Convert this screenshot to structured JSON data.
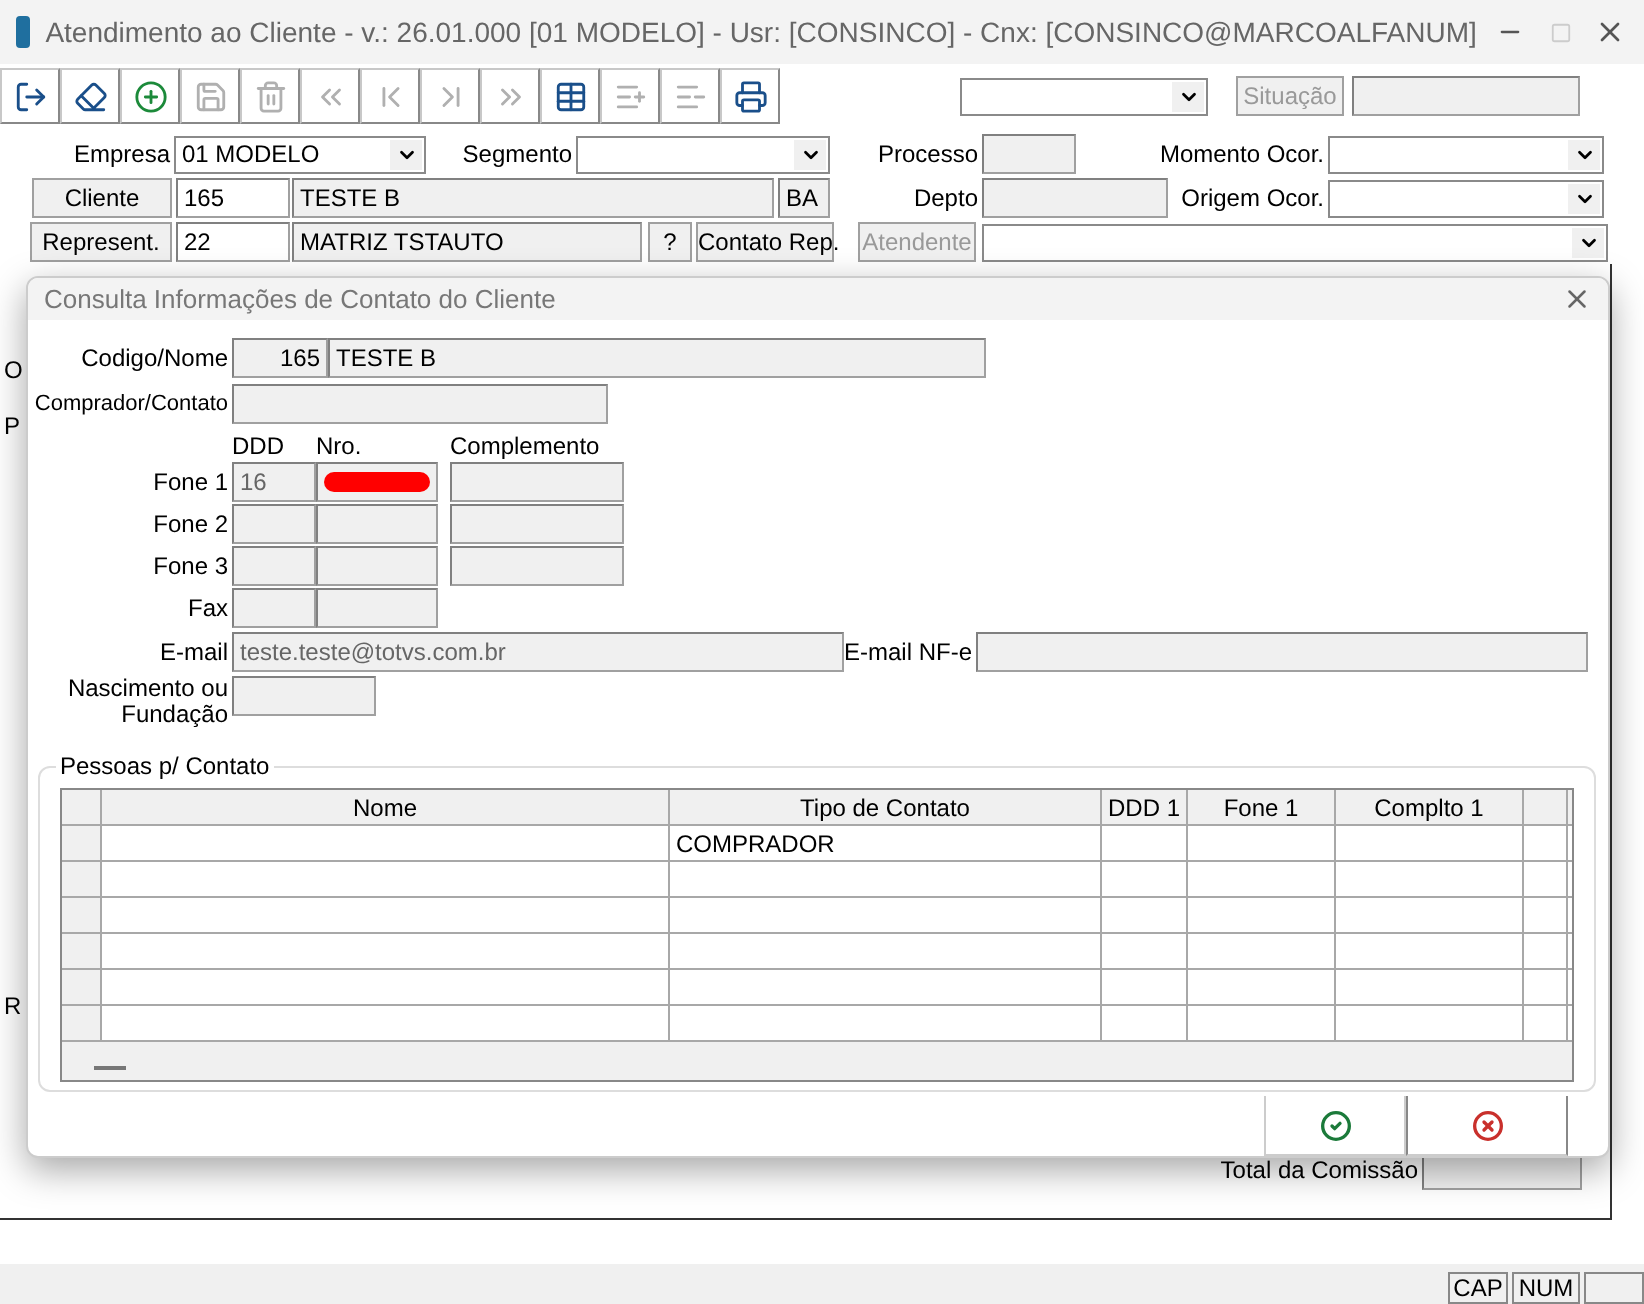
{
  "window": {
    "title": "Atendimento ao Cliente - v.: 26.01.000  [01 MODELO] - Usr: [CONSINCO] - Cnx: [CONSINCO@MARCOALFANUM]"
  },
  "toolbar": [
    {
      "disabled": false
    },
    {
      "disabled": false
    },
    {
      "disabled": false
    },
    {
      "disabled": true
    },
    {
      "disabled": true
    },
    {
      "disabled": true
    },
    {
      "disabled": true
    },
    {
      "disabled": true
    },
    {
      "disabled": true
    },
    {
      "disabled": false
    },
    {
      "disabled": true
    },
    {
      "disabled": true
    },
    {
      "disabled": false
    }
  ],
  "top_right": {
    "situacao_button": {
      "label": "Situação",
      "disabled": true
    }
  },
  "form": {
    "empresa": {
      "label": "Empresa",
      "value": "01 MODELO"
    },
    "segmento": {
      "label": "Segmento"
    },
    "processo": {
      "label": "Processo"
    },
    "momento": {
      "label": "Momento Ocor."
    },
    "cliente": {
      "button": "Cliente",
      "code": "165",
      "name": "TESTE B",
      "uf": "BA"
    },
    "depto": {
      "label": "Depto"
    },
    "origem": {
      "label": "Origem Ocor."
    },
    "represent": {
      "button": "Represent.",
      "code": "22",
      "name": "MATRIZ TSTAUTO",
      "help_button": "?",
      "contact_button": "Contato Rep."
    },
    "atendente": {
      "button": "Atendente",
      "disabled": true
    }
  },
  "background_fragments": [
    "O",
    "P",
    "R"
  ],
  "total_label": "Total da Comissão",
  "dialog": {
    "title": "Consulta Informações de Contato do Cliente",
    "codigo_label": "Codigo/Nome",
    "codigo": "165",
    "nome": "TESTE B",
    "comprador_label": "Comprador/Contato",
    "phone_headers": [
      "DDD",
      "Nro.",
      "Complemento"
    ],
    "phones": [
      {
        "label": "Fone 1",
        "ddd": "16",
        "redacted": true,
        "complement": true
      },
      {
        "label": "Fone 2",
        "redacted": false,
        "complement": true
      },
      {
        "label": "Fone 3",
        "redacted": false,
        "complement": true
      },
      {
        "label": "Fax",
        "redacted": false,
        "complement": false
      }
    ],
    "email_label": "E-mail",
    "email": "teste.teste@totvs.com.br",
    "email_nfe_label": "E-mail NF-e",
    "nascimento_label": "Nascimento ou Fundação",
    "group_title": "Pessoas p/ Contato",
    "columns": [
      "Nome",
      "Tipo de Contato",
      "DDD 1",
      "Fone 1",
      "Complto 1"
    ],
    "rows": [
      {
        "tipo_de_contato": "COMPRADOR"
      },
      {},
      {},
      {},
      {},
      {}
    ]
  },
  "status_bar": [
    "CAP",
    "NUM"
  ]
}
